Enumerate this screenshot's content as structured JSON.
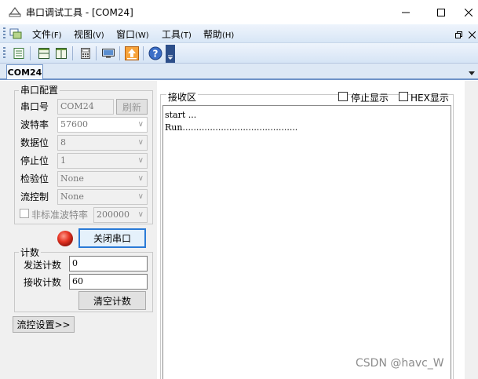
{
  "window": {
    "title": "串口调试工具 - [COM24]",
    "icon": "serial-app-icon",
    "controls": [
      "minimize-icon",
      "maximize-icon",
      "close-icon"
    ]
  },
  "menu": {
    "items": [
      {
        "label": "文件",
        "accel": "(F)"
      },
      {
        "label": "视图",
        "accel": "(V)"
      },
      {
        "label": "窗口",
        "accel": "(W)"
      },
      {
        "label": "工具",
        "accel": "(T)"
      },
      {
        "label": "帮助",
        "accel": "(H)"
      }
    ],
    "right_controls": [
      "restore-icon",
      "close-icon"
    ]
  },
  "toolbar": {
    "buttons": [
      "new-window-icon",
      "split-horizontal-icon",
      "split-vertical-icon",
      "calculator-icon",
      "monitor-icon",
      "upload-icon",
      "help-icon",
      "customize-icon"
    ]
  },
  "tabs": [
    {
      "label": "COM24",
      "active": true
    }
  ],
  "serial_config": {
    "title": "串口配置",
    "port": {
      "label": "串口号",
      "value": "COM24"
    },
    "refresh_label": "刷新",
    "baud": {
      "label": "波特率",
      "value": "57600"
    },
    "databits": {
      "label": "数据位",
      "value": "8"
    },
    "stopbits": {
      "label": "停止位",
      "value": "1"
    },
    "parity": {
      "label": "检验位",
      "value": "None"
    },
    "flow": {
      "label": "流控制",
      "value": "None"
    },
    "nonstd": {
      "label": "非标准波特率",
      "value": "200000",
      "checked": false
    },
    "status_color": "#e53322",
    "toggle_label": "关闭串口"
  },
  "counter": {
    "title": "计数",
    "sent": {
      "label": "发送计数",
      "value": "0"
    },
    "recv": {
      "label": "接收计数",
      "value": "60"
    },
    "clear_label": "清空计数"
  },
  "flow_settings_label": "流控设置>>",
  "receive": {
    "title": "接收区",
    "stop_display": {
      "label": "停止显示",
      "checked": false
    },
    "hex_display": {
      "label": "HEX显示",
      "checked": false
    },
    "content": "start ...\nRun.........................................."
  },
  "watermark": "CSDN @havc_W"
}
